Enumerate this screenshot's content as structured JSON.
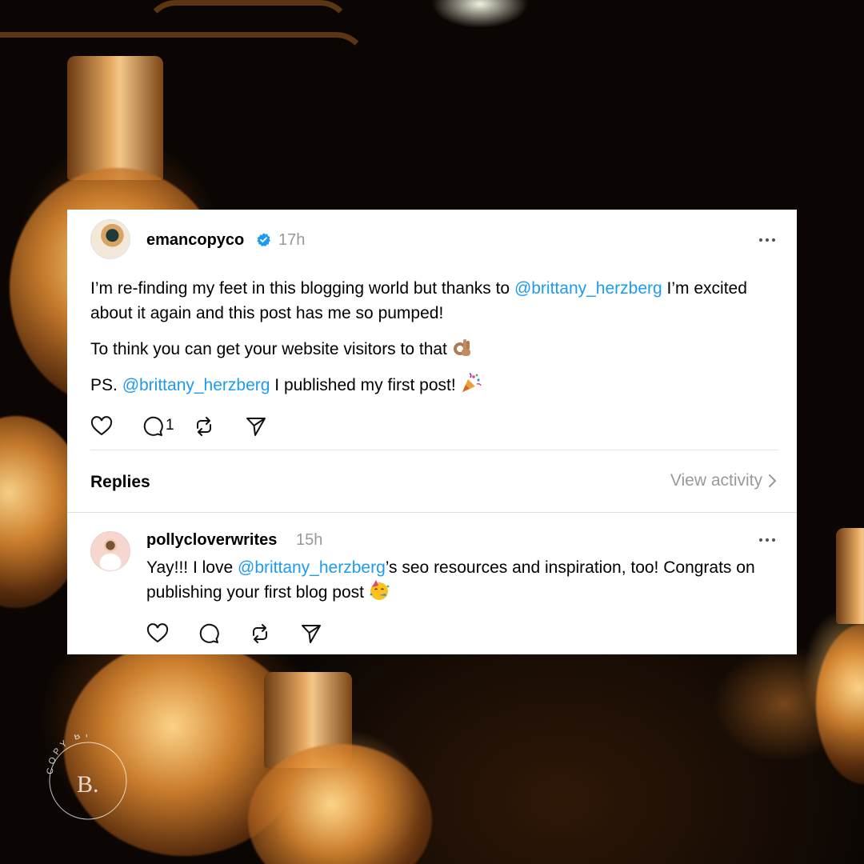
{
  "post": {
    "username": "emancopyco",
    "time": "17h",
    "line1_pre": "I’m re-finding my feet in this blogging world but thanks to ",
    "line1_mention": "@brittany_herzberg",
    "line1_post": " I’m excited about it again and this post has me so pumped!",
    "line2": "To think you can get your website visitors to that ",
    "line3_pre": "PS. ",
    "line3_mention": "@brittany_herzberg",
    "line3_post": " I published my first post! ",
    "reply_count": "1",
    "icons": [
      "heart-icon",
      "comment-icon",
      "repost-icon",
      "share-icon",
      "verified-icon",
      "more-icon",
      "ok-hand-emoji",
      "party-popper-emoji"
    ]
  },
  "replies_header": {
    "label": "Replies",
    "view_activity": "View activity"
  },
  "reply": {
    "username": "pollycloverwrites",
    "time": "15h",
    "text_pre": "Yay!!! I love ",
    "text_mention": "@brittany_herzberg",
    "text_post": "’s seo resources and inspiration, too! Congrats on publishing your first blog post ",
    "icons": [
      "heart-icon",
      "comment-icon",
      "repost-icon",
      "share-icon",
      "more-icon",
      "partying-face-emoji"
    ]
  },
  "watermark": {
    "top_text": "COPY BY",
    "initial": "B."
  },
  "colors": {
    "mention": "#1d9bf0",
    "muted": "#999999",
    "verified": "#1d9bf0"
  }
}
